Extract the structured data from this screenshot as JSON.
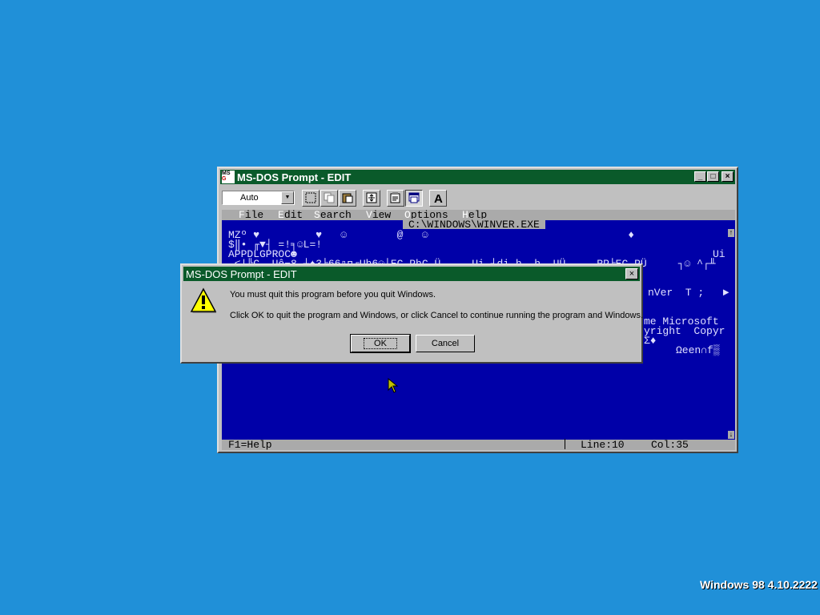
{
  "dos_window": {
    "title": "MS-DOS Prompt - EDIT",
    "icon_text_top": "MS",
    "icon_text_bottom": "G",
    "font_select": "Auto",
    "minimize": "_",
    "maximize": "□",
    "close": "×",
    "menu": {
      "file": {
        "hot": "F",
        "rest": "ile"
      },
      "edit": {
        "hot": "E",
        "rest": "dit"
      },
      "search": {
        "hot": "S",
        "rest": "earch"
      },
      "view": {
        "hot": "V",
        "rest": "iew"
      },
      "options": {
        "hot": "O",
        "rest": "ptions"
      },
      "help": {
        "hot": "H",
        "rest": "elp"
      }
    },
    "file_path": "C:\\WINDOWS\\WINVER.EXE",
    "lines": [
      "MZº ♥         ♥   ☺        @   ☺                                ♦",
      "$‖• ╓▼┤ =!╕☺L=!",
      "APPDLGPROC☻",
      "",
      "",
      "",
      "",
      "",
      "",
      ""
    ],
    "garble_line": " ≤|╚C  Uê⌐8 ┼♠3╘66ⁿп╒Uh6☺⌡EC PhC Ü     Ui ┤di h  h  UÜ     RP╞EC PÜ     ┐☺ ^┌╨",
    "right_fragments": {
      "ui": "Ui",
      "nver": "nVer  T ;   ►",
      "microsoft": "me Microsoft",
      "copyright": "yright  Copyr",
      "sigma": "Σ♦",
      "omega": "Ωeen∩f▒"
    },
    "status": {
      "help": "F1=Help",
      "line": "Line:10",
      "col": "Col:35"
    },
    "scroll_up": "↑",
    "scroll_down": "↓"
  },
  "dialog": {
    "title": "MS-DOS Prompt - EDIT",
    "close": "×",
    "message1": "You must quit this program before you quit Windows.",
    "message2": "Click OK to quit the program and Windows, or click Cancel to continue running the program and Windows.",
    "ok_label": "OK",
    "cancel_label": "Cancel"
  },
  "watermark": "Windows 98 4.10.2222",
  "colors": {
    "desktop": "#2090d8",
    "title_bar": "#0a5a2a",
    "dos_blue": "#0000a8"
  }
}
